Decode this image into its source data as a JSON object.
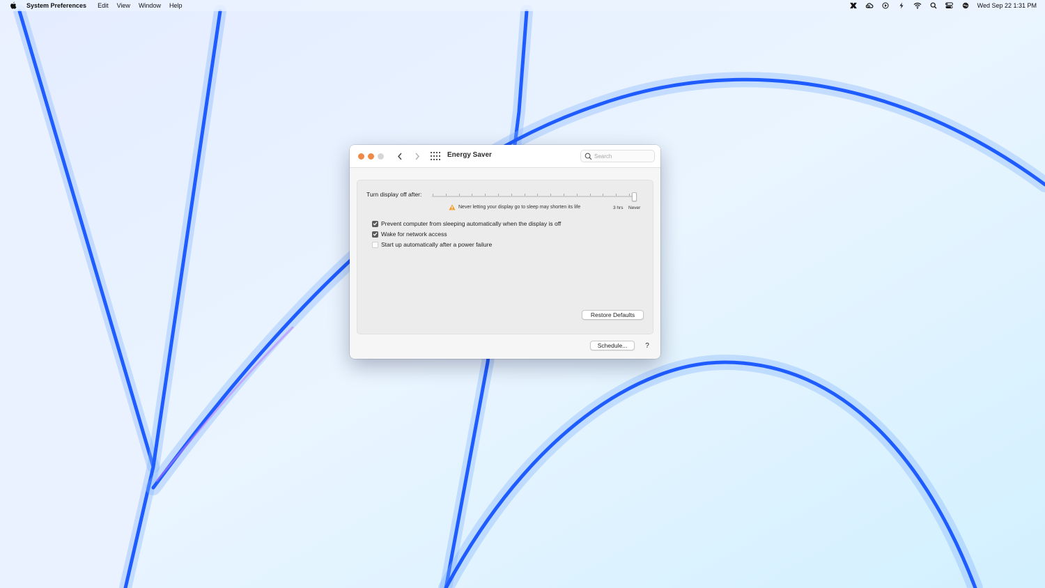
{
  "menubar": {
    "app_name": "System Preferences",
    "items": [
      "Edit",
      "View",
      "Window",
      "Help"
    ],
    "clock": "Wed Sep 22  1:31 PM"
  },
  "window": {
    "title": "Energy Saver",
    "search": {
      "placeholder": "Search",
      "value": ""
    }
  },
  "display_sleep": {
    "label": "Turn display off after:",
    "warning": "Never letting your display go to sleep may shorten its life",
    "labels": [
      "3 hrs",
      "Never"
    ],
    "value": "Never",
    "position_fraction": 1.0
  },
  "options": [
    {
      "label": "Prevent computer from sleeping automatically when the display is off",
      "checked": true
    },
    {
      "label": "Wake for network access",
      "checked": true
    },
    {
      "label": "Start up automatically after a power failure",
      "checked": false
    }
  ],
  "buttons": {
    "restore_defaults": "Restore Defaults",
    "schedule": "Schedule...",
    "help": "?"
  },
  "colors": {
    "traffic_active": "#ee8a45",
    "traffic_inactive": "#d6d6d6",
    "checkbox_checked": "#5b5b5b",
    "warning": "#f0a030"
  }
}
